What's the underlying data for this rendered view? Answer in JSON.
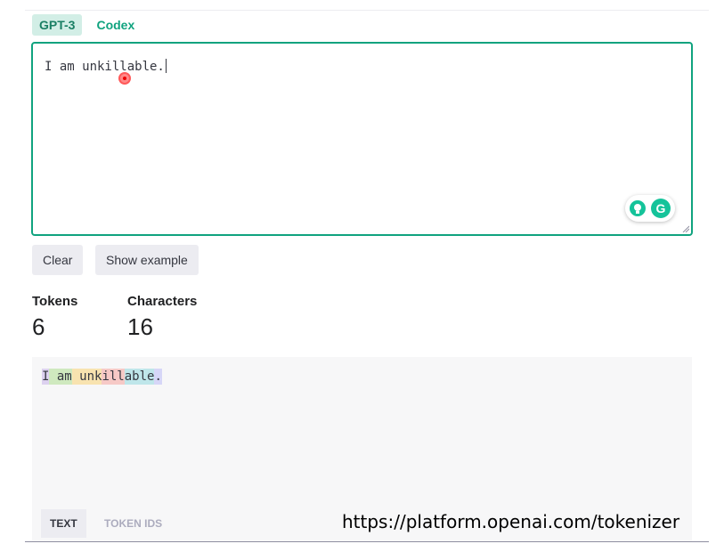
{
  "tabs": [
    {
      "label": "GPT-3",
      "active": true
    },
    {
      "label": "Codex",
      "active": false
    }
  ],
  "editor": {
    "value": "I am unkillable."
  },
  "buttons": {
    "clear": "Clear",
    "show_example": "Show example"
  },
  "stats": {
    "tokens_label": "Tokens",
    "tokens_value": "6",
    "characters_label": "Characters",
    "characters_value": "16"
  },
  "output": {
    "tokens": [
      {
        "text": "I",
        "color": "#dcd1ef"
      },
      {
        "text": " am",
        "color": "#cfe9bf"
      },
      {
        "text": " unk",
        "color": "#f8e3b0"
      },
      {
        "text": "ill",
        "color": "#f6c9c6"
      },
      {
        "text": "able",
        "color": "#bfe6ea"
      },
      {
        "text": ".",
        "color": "#d6d6f7"
      }
    ],
    "tabs": {
      "text": "TEXT",
      "token_ids": "TOKEN IDS"
    }
  },
  "caption_url": "https://platform.openai.com/tokenizer",
  "colors": {
    "accent": "#10a37f",
    "grammarly": "#15c39a"
  },
  "icons": {
    "extension_1": "lightbulb-icon",
    "extension_2": "grammarly-icon"
  }
}
